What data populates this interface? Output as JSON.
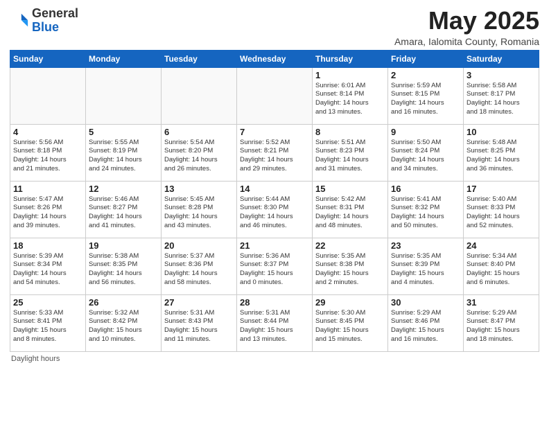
{
  "logo": {
    "general": "General",
    "blue": "Blue"
  },
  "title": "May 2025",
  "subtitle": "Amara, Ialomita County, Romania",
  "days_of_week": [
    "Sunday",
    "Monday",
    "Tuesday",
    "Wednesday",
    "Thursday",
    "Friday",
    "Saturday"
  ],
  "footer": "Daylight hours",
  "weeks": [
    [
      {
        "day": "",
        "content": "",
        "empty": true
      },
      {
        "day": "",
        "content": "",
        "empty": true
      },
      {
        "day": "",
        "content": "",
        "empty": true
      },
      {
        "day": "",
        "content": "",
        "empty": true
      },
      {
        "day": "1",
        "content": "Sunrise: 6:01 AM\nSunset: 8:14 PM\nDaylight: 14 hours\nand 13 minutes."
      },
      {
        "day": "2",
        "content": "Sunrise: 5:59 AM\nSunset: 8:15 PM\nDaylight: 14 hours\nand 16 minutes."
      },
      {
        "day": "3",
        "content": "Sunrise: 5:58 AM\nSunset: 8:17 PM\nDaylight: 14 hours\nand 18 minutes."
      }
    ],
    [
      {
        "day": "4",
        "content": "Sunrise: 5:56 AM\nSunset: 8:18 PM\nDaylight: 14 hours\nand 21 minutes."
      },
      {
        "day": "5",
        "content": "Sunrise: 5:55 AM\nSunset: 8:19 PM\nDaylight: 14 hours\nand 24 minutes."
      },
      {
        "day": "6",
        "content": "Sunrise: 5:54 AM\nSunset: 8:20 PM\nDaylight: 14 hours\nand 26 minutes."
      },
      {
        "day": "7",
        "content": "Sunrise: 5:52 AM\nSunset: 8:21 PM\nDaylight: 14 hours\nand 29 minutes."
      },
      {
        "day": "8",
        "content": "Sunrise: 5:51 AM\nSunset: 8:23 PM\nDaylight: 14 hours\nand 31 minutes."
      },
      {
        "day": "9",
        "content": "Sunrise: 5:50 AM\nSunset: 8:24 PM\nDaylight: 14 hours\nand 34 minutes."
      },
      {
        "day": "10",
        "content": "Sunrise: 5:48 AM\nSunset: 8:25 PM\nDaylight: 14 hours\nand 36 minutes."
      }
    ],
    [
      {
        "day": "11",
        "content": "Sunrise: 5:47 AM\nSunset: 8:26 PM\nDaylight: 14 hours\nand 39 minutes."
      },
      {
        "day": "12",
        "content": "Sunrise: 5:46 AM\nSunset: 8:27 PM\nDaylight: 14 hours\nand 41 minutes."
      },
      {
        "day": "13",
        "content": "Sunrise: 5:45 AM\nSunset: 8:28 PM\nDaylight: 14 hours\nand 43 minutes."
      },
      {
        "day": "14",
        "content": "Sunrise: 5:44 AM\nSunset: 8:30 PM\nDaylight: 14 hours\nand 46 minutes."
      },
      {
        "day": "15",
        "content": "Sunrise: 5:42 AM\nSunset: 8:31 PM\nDaylight: 14 hours\nand 48 minutes."
      },
      {
        "day": "16",
        "content": "Sunrise: 5:41 AM\nSunset: 8:32 PM\nDaylight: 14 hours\nand 50 minutes."
      },
      {
        "day": "17",
        "content": "Sunrise: 5:40 AM\nSunset: 8:33 PM\nDaylight: 14 hours\nand 52 minutes."
      }
    ],
    [
      {
        "day": "18",
        "content": "Sunrise: 5:39 AM\nSunset: 8:34 PM\nDaylight: 14 hours\nand 54 minutes."
      },
      {
        "day": "19",
        "content": "Sunrise: 5:38 AM\nSunset: 8:35 PM\nDaylight: 14 hours\nand 56 minutes."
      },
      {
        "day": "20",
        "content": "Sunrise: 5:37 AM\nSunset: 8:36 PM\nDaylight: 14 hours\nand 58 minutes."
      },
      {
        "day": "21",
        "content": "Sunrise: 5:36 AM\nSunset: 8:37 PM\nDaylight: 15 hours\nand 0 minutes."
      },
      {
        "day": "22",
        "content": "Sunrise: 5:35 AM\nSunset: 8:38 PM\nDaylight: 15 hours\nand 2 minutes."
      },
      {
        "day": "23",
        "content": "Sunrise: 5:35 AM\nSunset: 8:39 PM\nDaylight: 15 hours\nand 4 minutes."
      },
      {
        "day": "24",
        "content": "Sunrise: 5:34 AM\nSunset: 8:40 PM\nDaylight: 15 hours\nand 6 minutes."
      }
    ],
    [
      {
        "day": "25",
        "content": "Sunrise: 5:33 AM\nSunset: 8:41 PM\nDaylight: 15 hours\nand 8 minutes."
      },
      {
        "day": "26",
        "content": "Sunrise: 5:32 AM\nSunset: 8:42 PM\nDaylight: 15 hours\nand 10 minutes."
      },
      {
        "day": "27",
        "content": "Sunrise: 5:31 AM\nSunset: 8:43 PM\nDaylight: 15 hours\nand 11 minutes."
      },
      {
        "day": "28",
        "content": "Sunrise: 5:31 AM\nSunset: 8:44 PM\nDaylight: 15 hours\nand 13 minutes."
      },
      {
        "day": "29",
        "content": "Sunrise: 5:30 AM\nSunset: 8:45 PM\nDaylight: 15 hours\nand 15 minutes."
      },
      {
        "day": "30",
        "content": "Sunrise: 5:29 AM\nSunset: 8:46 PM\nDaylight: 15 hours\nand 16 minutes."
      },
      {
        "day": "31",
        "content": "Sunrise: 5:29 AM\nSunset: 8:47 PM\nDaylight: 15 hours\nand 18 minutes."
      }
    ]
  ]
}
